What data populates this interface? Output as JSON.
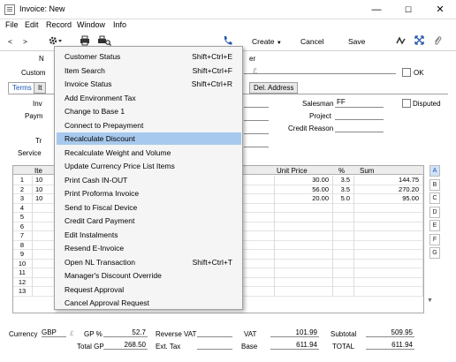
{
  "window": {
    "title": "Invoice: New",
    "min": "—",
    "max": "☐",
    "close": "✕"
  },
  "menubar": [
    "File",
    "Edit",
    "Record",
    "Window",
    "Info"
  ],
  "toolbar": {
    "back": "<",
    "forward": ">",
    "create": "Create",
    "cancel": "Cancel",
    "save": "Save"
  },
  "header": {
    "no_label": "N",
    "customer_label": "Custom",
    "salesman_partial": "er",
    "ok_label": "OK",
    "invoice_label": "Inv",
    "payment_label": "Paym",
    "tr_label": "Tr",
    "service_label": "Service"
  },
  "tabs": [
    "Terms",
    "It",
    "Del. Address"
  ],
  "right_fields": {
    "salesman_label": "Salesman",
    "salesman_value": "FF",
    "disputed_label": "Disputed",
    "project_label": "Project",
    "credit_reason_label": "Credit Reason"
  },
  "grid": {
    "headers": [
      "",
      "Ite",
      "Unit Price",
      "%",
      "Sum"
    ],
    "rows": [
      {
        "n": "1",
        "item": "10",
        "price": "30.00",
        "pct": "3.5",
        "sum": "144.75"
      },
      {
        "n": "2",
        "item": "10",
        "price": "56.00",
        "pct": "3.5",
        "sum": "270.20"
      },
      {
        "n": "3",
        "item": "10",
        "price": "20.00",
        "pct": "5.0",
        "sum": "95.00"
      },
      {
        "n": "4",
        "item": "",
        "price": "",
        "pct": "",
        "sum": ""
      },
      {
        "n": "5",
        "item": "",
        "price": "",
        "pct": "",
        "sum": ""
      },
      {
        "n": "6",
        "item": "",
        "price": "",
        "pct": "",
        "sum": ""
      },
      {
        "n": "7",
        "item": "",
        "price": "",
        "pct": "",
        "sum": ""
      },
      {
        "n": "8",
        "item": "",
        "price": "",
        "pct": "",
        "sum": ""
      },
      {
        "n": "9",
        "item": "",
        "price": "",
        "pct": "",
        "sum": ""
      },
      {
        "n": "10",
        "item": "",
        "price": "",
        "pct": "",
        "sum": ""
      },
      {
        "n": "11",
        "item": "",
        "price": "",
        "pct": "",
        "sum": ""
      },
      {
        "n": "12",
        "item": "",
        "price": "",
        "pct": "",
        "sum": ""
      },
      {
        "n": "13",
        "item": "",
        "price": "",
        "pct": "",
        "sum": ""
      }
    ],
    "side_tabs": [
      "A",
      "B",
      "C",
      "D",
      "E",
      "F",
      "G"
    ]
  },
  "footer": {
    "currency_label": "Currency",
    "currency_value": "GBP",
    "gp_pct_label": "GP %",
    "gp_pct_value": "52.7",
    "reverse_vat_label": "Reverse VAT",
    "reverse_vat_value": "",
    "vat_label": "VAT",
    "vat_value": "101.99",
    "subtotal_label": "Subtotal",
    "subtotal_value": "509.95",
    "total_gp_label": "Total GP",
    "total_gp_value": "268.50",
    "ext_tax_label": "Ext. Tax",
    "ext_tax_value": "",
    "base_label": "Base",
    "base_value": "611.94",
    "total_label": "TOTAL",
    "total_value": "611.94"
  },
  "context_menu": [
    {
      "label": "Customer Status",
      "shortcut": "Shift+Ctrl+E"
    },
    {
      "label": "Item Search",
      "shortcut": "Shift+Ctrl+F"
    },
    {
      "label": "Invoice Status",
      "shortcut": "Shift+Ctrl+R"
    },
    {
      "label": "Add Environment Tax",
      "shortcut": ""
    },
    {
      "label": "Change to Base 1",
      "shortcut": ""
    },
    {
      "label": "Connect to Prepayment",
      "shortcut": ""
    },
    {
      "label": "Recalculate Discount",
      "shortcut": ""
    },
    {
      "label": "Recalculate Weight and Volume",
      "shortcut": ""
    },
    {
      "label": "Update Currency Price List Items",
      "shortcut": ""
    },
    {
      "label": "Print Cash IN-OUT",
      "shortcut": ""
    },
    {
      "label": "Print Proforma Invoice",
      "shortcut": ""
    },
    {
      "label": "Send to Fiscal Device",
      "shortcut": ""
    },
    {
      "label": "Credit Card Payment",
      "shortcut": ""
    },
    {
      "label": "Edit Instalments",
      "shortcut": ""
    },
    {
      "label": "Resend E-Invoice",
      "shortcut": ""
    },
    {
      "label": "Open NL Transaction",
      "shortcut": "Shift+Ctrl+T"
    },
    {
      "label": "Manager's Discount Override",
      "shortcut": ""
    },
    {
      "label": "Request Approval",
      "shortcut": ""
    },
    {
      "label": "Cancel Approval Request",
      "shortcut": ""
    }
  ],
  "colors": {
    "highlight": "#a7c9ed",
    "accent": "#1a55b5"
  }
}
